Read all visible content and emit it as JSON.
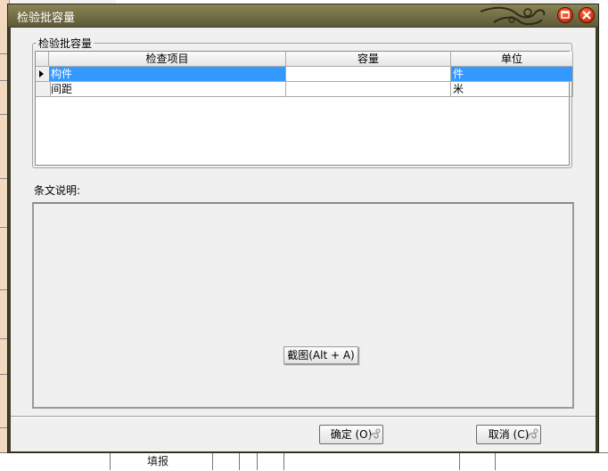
{
  "background": {
    "bottom_text": "填报"
  },
  "dialog": {
    "title": "检验批容量"
  },
  "group": {
    "legend": "检验批容量",
    "columns": [
      "检查项目",
      "容量",
      "单位"
    ],
    "rows": [
      {
        "item": "构件",
        "capacity": "",
        "unit": "件"
      },
      {
        "item": "间距",
        "capacity": "",
        "unit": "米"
      }
    ]
  },
  "description": {
    "label": "条文说明:"
  },
  "overlay": {
    "snip_label": "截图(Alt + A)"
  },
  "buttons": {
    "ok_label": "确定 (O)",
    "cancel_label": "取消 (C)"
  },
  "colors": {
    "selection": "#3399ff",
    "titlebar": "#6f6a45",
    "close_button": "#d8361a"
  },
  "icons": [
    "maximize-icon",
    "close-icon",
    "row-pointer-icon",
    "title-ornament"
  ]
}
